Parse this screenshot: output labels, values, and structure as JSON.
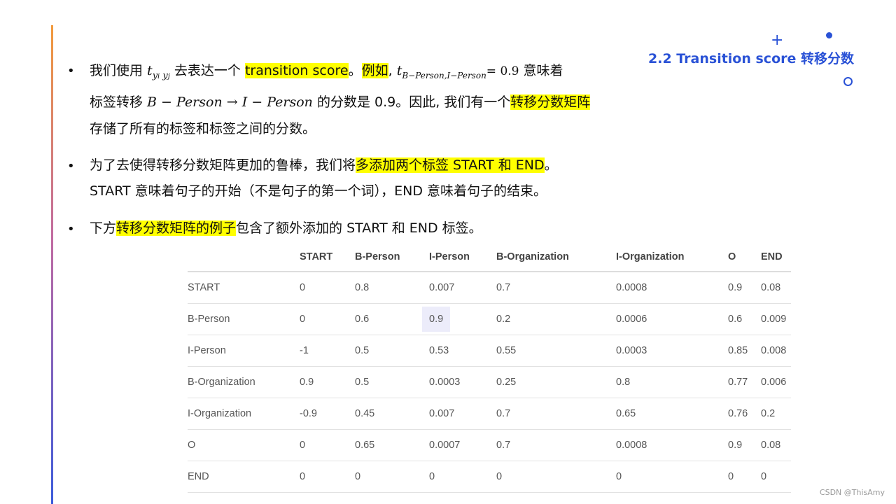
{
  "slide": {
    "title": "2.2 Transition score 转移分数",
    "colors": {
      "accent": "#2a52d6",
      "highlight": "#ffff00"
    }
  },
  "bullet1": {
    "line1_a": "我们使用 ",
    "math_t": "t",
    "math_yi": "y",
    "math_i": "i",
    "math_yj": "y",
    "math_j": "j",
    "line1_b": " 去表达一个 ",
    "hl1": "transition score",
    "line1_c": "。",
    "hl2": "例如",
    "line1_d": ", ",
    "math_t2": "t",
    "math_sub2": "B−Person,I−Person",
    "math_eq": "= 0.9",
    "line1_e": " 意味着",
    "line2_a": "标签转移 ",
    "math_bp": "B − Person",
    "math_arrow": " → ",
    "math_ip": "I − Person",
    "line2_b": " 的分数是 0.9。因此, 我们有一个",
    "hl3": "转移分数矩阵",
    "line3": "存储了所有的标签和标签之间的分数。"
  },
  "bullet2": {
    "line1_a": "为了去使得转移分数矩阵更加的鲁棒，我们将",
    "hl": "多添加两个标签  START  和  END",
    "line1_b": "。",
    "line2": "START  意味着句子的开始（不是句子的第一个词），END  意味着句子的结束。"
  },
  "bullet3": {
    "a": "下方",
    "hl": "转移分数矩阵的例子",
    "b": "包含了额外添加的  START 和 END 标签。"
  },
  "table": {
    "headers": [
      "",
      "START",
      "B-Person",
      "I-Person",
      "B-Organization",
      "I-Organization",
      "O",
      "END"
    ],
    "rows": [
      [
        "START",
        "0",
        "0.8",
        "0.007",
        "0.7",
        "0.0008",
        "0.9",
        "0.08"
      ],
      [
        "B-Person",
        "0",
        "0.6",
        "0.9",
        "0.2",
        "0.0006",
        "0.6",
        "0.009"
      ],
      [
        "I-Person",
        "-1",
        "0.5",
        "0.53",
        "0.55",
        "0.0003",
        "0.85",
        "0.008"
      ],
      [
        "B-Organization",
        "0.9",
        "0.5",
        "0.0003",
        "0.25",
        "0.8",
        "0.77",
        "0.006"
      ],
      [
        "I-Organization",
        "-0.9",
        "0.45",
        "0.007",
        "0.7",
        "0.65",
        "0.76",
        "0.2"
      ],
      [
        "O",
        "0",
        "0.65",
        "0.0007",
        "0.7",
        "0.0008",
        "0.9",
        "0.08"
      ],
      [
        "END",
        "0",
        "0",
        "0",
        "0",
        "0",
        "0",
        "0"
      ]
    ]
  },
  "watermark": "CSDN @ThisAmy"
}
